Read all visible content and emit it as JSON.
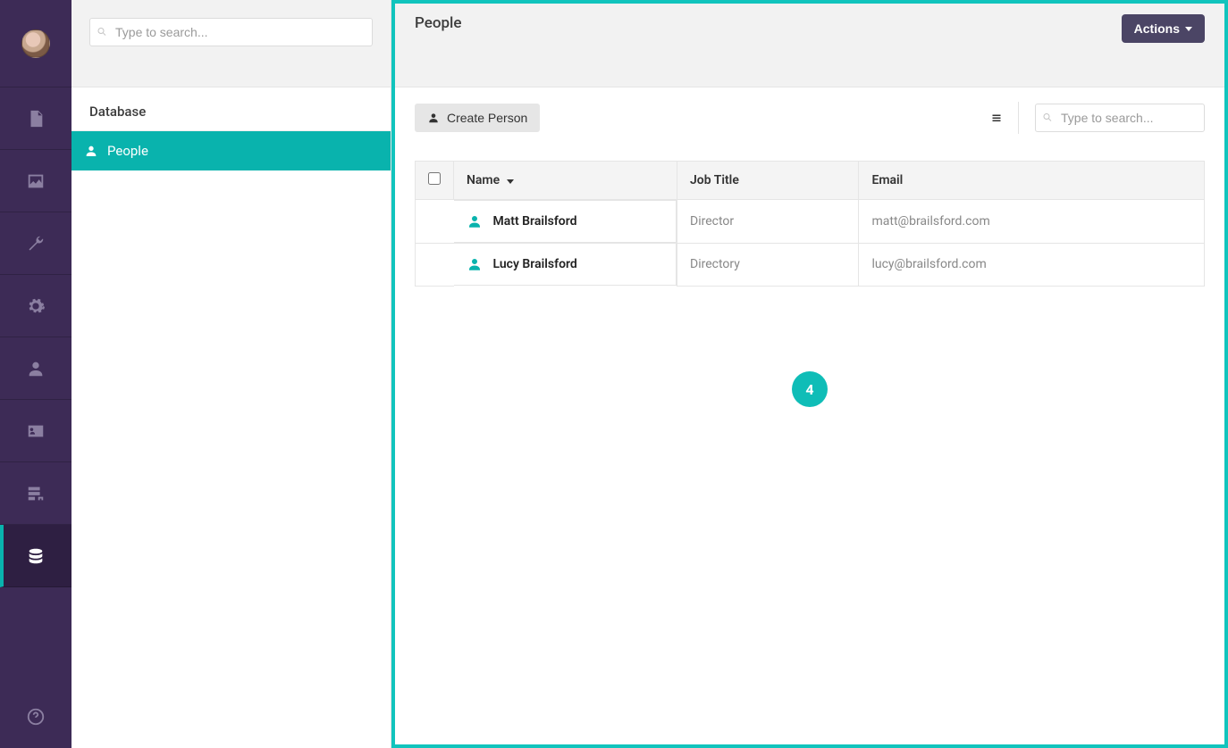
{
  "rail": {
    "icons": [
      "document",
      "image",
      "wrench",
      "gear",
      "user",
      "card",
      "form",
      "database"
    ],
    "active_index": 7
  },
  "tree": {
    "search_placeholder": "Type to search...",
    "section_title": "Database",
    "items": [
      {
        "label": "People",
        "selected": true
      }
    ]
  },
  "main": {
    "title": "People",
    "actions_label": "Actions",
    "create_label": "Create Person",
    "table_search_placeholder": "Type to search...",
    "columns": {
      "name": "Name",
      "job_title": "Job Title",
      "email": "Email"
    },
    "rows": [
      {
        "name": "Matt Brailsford",
        "job_title": "Director",
        "email": "matt@brailsford.com"
      },
      {
        "name": "Lucy Brailsford",
        "job_title": "Directory",
        "email": "lucy@brailsford.com"
      }
    ]
  },
  "annotation": {
    "number": "4"
  }
}
